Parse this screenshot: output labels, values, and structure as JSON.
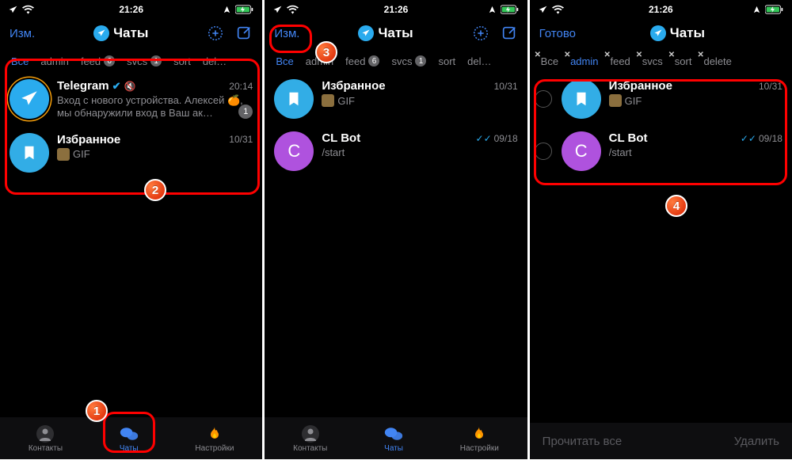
{
  "status": {
    "time": "21:26"
  },
  "screens": [
    {
      "left_button": "Изм.",
      "title": "Чаты",
      "actions": [
        "add",
        "compose"
      ],
      "tabs": [
        {
          "label": "Все",
          "active": true
        },
        {
          "label": "admin"
        },
        {
          "label": "feed",
          "count": "6"
        },
        {
          "label": "svcs",
          "count": "1"
        },
        {
          "label": "sort"
        },
        {
          "label": "del…"
        }
      ],
      "chats": [
        {
          "avatar": "tg",
          "ring": true,
          "name": "Telegram",
          "verified": true,
          "muted": true,
          "ts": "20:14",
          "unread": "1",
          "preview_kind": "text",
          "preview": "Вход с нового устройства. Алексей 🍊, мы обнаружили вход в Ваш ак…"
        },
        {
          "avatar": "fav",
          "name": "Избранное",
          "ts": "10/31",
          "preview_kind": "gif",
          "preview": "GIF"
        }
      ],
      "tabbar": [
        {
          "icon": "contacts",
          "label": "Контакты"
        },
        {
          "icon": "chats",
          "label": "Чаты",
          "active": true
        },
        {
          "icon": "settings",
          "label": "Настройки"
        }
      ]
    },
    {
      "left_button": "Изм.",
      "title": "Чаты",
      "actions": [
        "add",
        "compose"
      ],
      "tabs": [
        {
          "label": "Все",
          "active": true
        },
        {
          "label": "admin"
        },
        {
          "label": "feed",
          "count": "6"
        },
        {
          "label": "svcs",
          "count": "1"
        },
        {
          "label": "sort"
        },
        {
          "label": "del…"
        }
      ],
      "chats": [
        {
          "avatar": "fav",
          "name": "Избранное",
          "ts": "10/31",
          "preview_kind": "gif",
          "preview": "GIF"
        },
        {
          "avatar": "cl",
          "initial": "C",
          "name": "CL Bot",
          "ts": "09/18",
          "checks": true,
          "preview_kind": "text",
          "preview": "/start"
        }
      ],
      "tabbar": [
        {
          "icon": "contacts",
          "label": "Контакты"
        },
        {
          "icon": "chats",
          "label": "Чаты",
          "active": true
        },
        {
          "icon": "settings",
          "label": "Настройки"
        }
      ]
    },
    {
      "left_button": "Готово",
      "title": "Чаты",
      "actions": [],
      "tabs_closable": true,
      "tabs": [
        {
          "label": "Все",
          "cx": true
        },
        {
          "label": "admin",
          "active": true,
          "cx": true
        },
        {
          "label": "feed",
          "cx": true
        },
        {
          "label": "svcs",
          "cx": true
        },
        {
          "label": "sort",
          "cx": true
        },
        {
          "label": "delete",
          "cx": true
        }
      ],
      "editing": true,
      "chats": [
        {
          "avatar": "fav",
          "name": "Избранное",
          "ts": "10/31",
          "preview_kind": "gif",
          "preview": "GIF"
        },
        {
          "avatar": "cl",
          "initial": "C",
          "name": "CL Bot",
          "ts": "09/18",
          "checks": true,
          "preview_kind": "text",
          "preview": "/start"
        }
      ],
      "editbar": {
        "left": "Прочитать все",
        "right": "Удалить"
      }
    }
  ],
  "callouts": {
    "1": "1",
    "2": "2",
    "3": "3",
    "4": "4"
  }
}
